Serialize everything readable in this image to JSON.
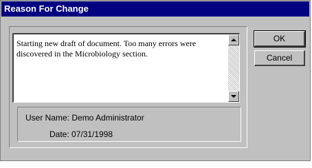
{
  "window": {
    "title": "Reason For Change"
  },
  "reason": {
    "text": "Starting new draft of document.  Too many errors were discovered in the Microbiology section."
  },
  "info": {
    "user_name_label": "User Name: Demo Administrator",
    "date_label": "Date: 07/31/1998"
  },
  "buttons": {
    "ok_label": "OK",
    "cancel_label": "Cancel"
  },
  "colors": {
    "titlebar": "#000080",
    "face": "#c0c0c0"
  },
  "icons": {
    "scroll_up": "arrow-up-icon",
    "scroll_down": "arrow-down-icon"
  }
}
